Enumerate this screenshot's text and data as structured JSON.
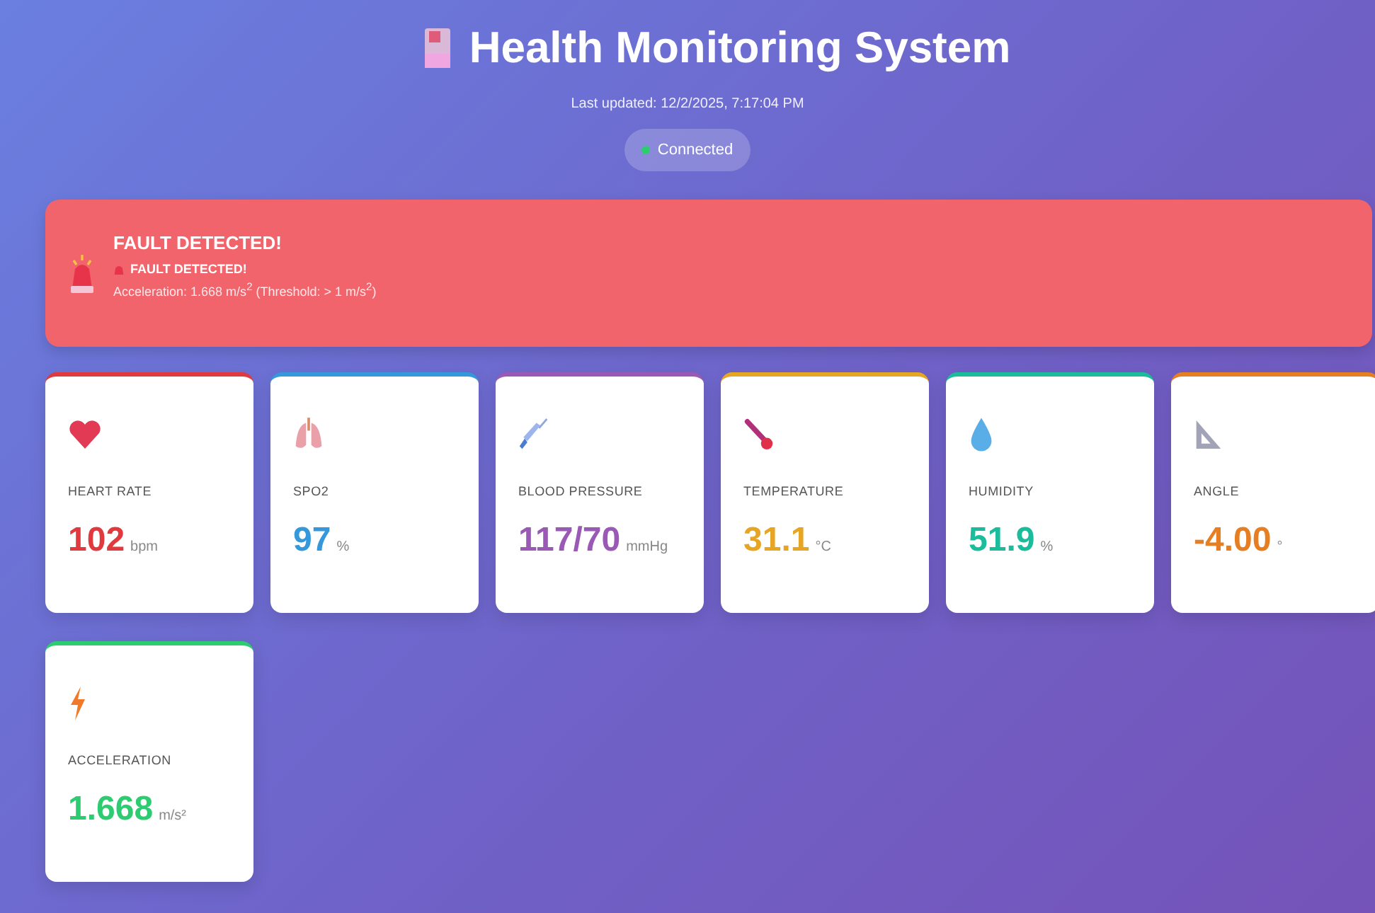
{
  "header": {
    "title": "Health Monitoring System",
    "last_updated": "Last updated: 12/2/2025, 7:17:04 PM",
    "status": {
      "label": "Connected",
      "connected": true
    }
  },
  "alert": {
    "title": "FAULT DETECTED!",
    "subtitle": "FAULT DETECTED!",
    "message": "Acceleration: 1.668 m/s$^{2}$ (Threshold: > 1 m/s$^{2}$)"
  },
  "metrics": [
    {
      "kind": "heart",
      "label": "HEART RATE",
      "value": "102",
      "unit": "bpm",
      "color": "#e0393e"
    },
    {
      "kind": "lungs",
      "label": "SPO2",
      "value": "97",
      "unit": "%",
      "color": "#3498db"
    },
    {
      "kind": "syringe",
      "label": "BLOOD PRESSURE",
      "value": "117/70",
      "unit": "mmHg",
      "color": "#9b59b6"
    },
    {
      "kind": "thermometer",
      "label": "TEMPERATURE",
      "value": "31.1",
      "unit": "°C",
      "color": "#e6a623"
    },
    {
      "kind": "droplet",
      "label": "HUMIDITY",
      "value": "51.9",
      "unit": "%",
      "color": "#1abc9c"
    },
    {
      "kind": "ruler",
      "label": "ANGLE",
      "value": "-4.00",
      "unit": "°",
      "color": "#e67e22"
    },
    {
      "kind": "bolt",
      "label": "ACCELERATION",
      "value": "1.668",
      "unit": "m/s²",
      "color": "#2ecc71"
    }
  ]
}
